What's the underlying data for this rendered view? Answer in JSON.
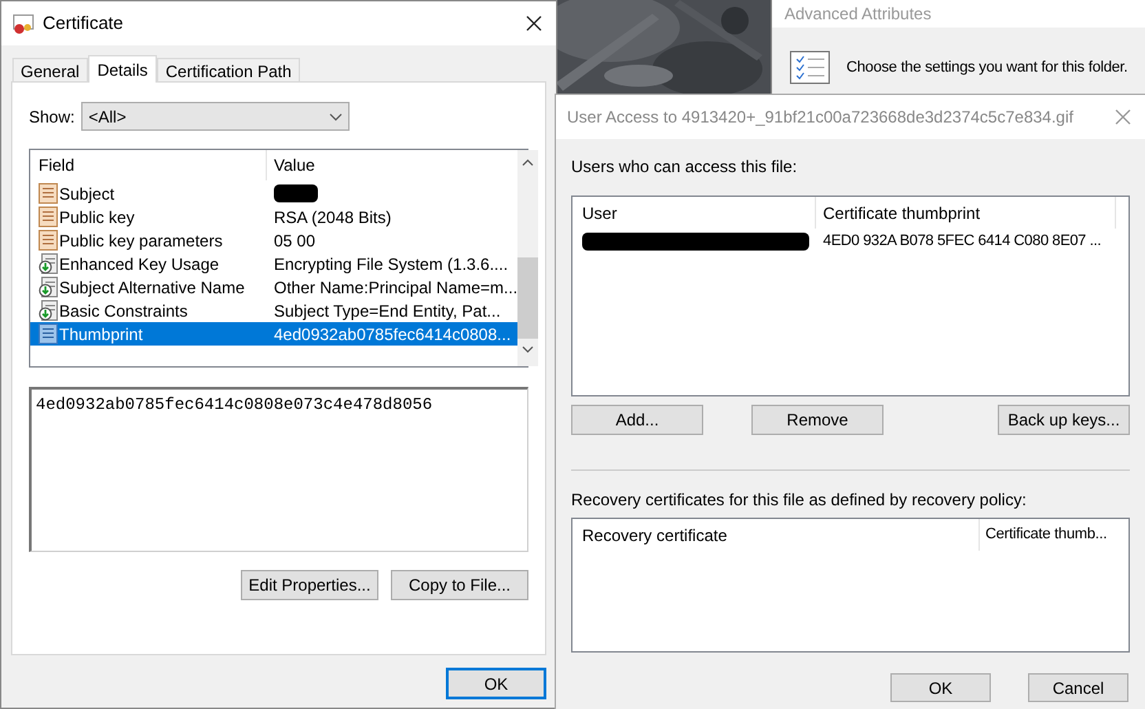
{
  "certificate_window": {
    "title": "Certificate",
    "tabs": [
      {
        "label": "General",
        "selected": false
      },
      {
        "label": "Details",
        "selected": true
      },
      {
        "label": "Certification Path",
        "selected": false
      }
    ],
    "show": {
      "label": "Show:",
      "value": "<All>"
    },
    "field_list": {
      "columns": [
        "Field",
        "Value"
      ],
      "rows": [
        {
          "field": "Subject",
          "value_redacted": true,
          "kind": "document",
          "selected": false
        },
        {
          "field": "Public key",
          "value": "RSA (2048 Bits)",
          "kind": "document",
          "selected": false
        },
        {
          "field": "Public key parameters",
          "value": "05 00",
          "kind": "document",
          "selected": false
        },
        {
          "field": "Enhanced Key Usage",
          "value": "Encrypting File System (1.3.6....",
          "kind": "extension",
          "selected": false
        },
        {
          "field": "Subject Alternative Name",
          "value": "Other Name:Principal Name=m...",
          "kind": "extension",
          "selected": false
        },
        {
          "field": "Basic Constraints",
          "value": "Subject Type=End Entity, Pat...",
          "kind": "extension",
          "selected": false
        },
        {
          "field": "Thumbprint",
          "value": "4ed0932ab0785fec6414c0808...",
          "kind": "property",
          "selected": true
        }
      ]
    },
    "detail_text": "4ed0932ab0785fec6414c0808e073c4e478d8056",
    "buttons": [
      "Edit Properties...",
      "Copy to File..."
    ],
    "ok_button": "OK"
  },
  "advanced_attributes_window": {
    "title": "Advanced Attributes",
    "description": "Choose the settings you want for this folder."
  },
  "user_access_window": {
    "title": "User Access to 4913420+_91bf21c00a723668de3d2374c5c7e834.gif",
    "users_label": "Users who can access this file:",
    "users_table": {
      "columns": [
        "User",
        "Certificate thumbprint"
      ],
      "rows": [
        {
          "user_redacted": true,
          "thumbprint": "4ED0 932A B078 5FEC 6414 C080 8E07 ..."
        }
      ]
    },
    "buttons": [
      "Add...",
      "Remove",
      "Back up keys..."
    ],
    "recovery_label": "Recovery certificates for this file as defined by recovery policy:",
    "recovery_table": {
      "columns": [
        "Recovery certificate",
        "Certificate thumb..."
      ]
    },
    "ok_button": "OK",
    "cancel_button": "Cancel"
  }
}
